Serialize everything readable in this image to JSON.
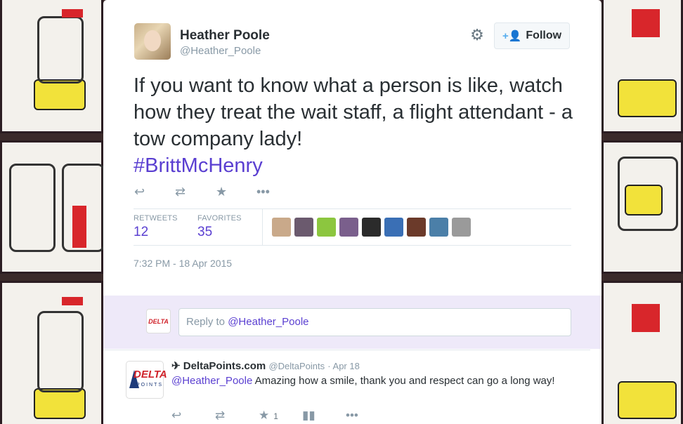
{
  "tweet": {
    "author_name": "Heather Poole",
    "author_handle": "@Heather_Poole",
    "follow_label": "Follow",
    "text": "If you want to know what a person is like, watch how they treat the wait staff, a flight attendant - a tow company lady!",
    "hashtag": "#BrittMcHenry",
    "retweets_label": "RETWEETS",
    "retweets_count": "12",
    "favorites_label": "FAVORITES",
    "favorites_count": "35",
    "timestamp": "7:32 PM - 18 Apr 2015",
    "favoriter_avatar_colors": [
      "#c9a98a",
      "#6b5a6e",
      "#8cc63f",
      "#7a5f8c",
      "#2b2b2b",
      "#3a6fb5",
      "#6b3a2a",
      "#4b7fa8",
      "#9a9a9a"
    ]
  },
  "reply_box": {
    "prefix": "Reply to ",
    "mention": "@Heather_Poole"
  },
  "reply_tweet": {
    "name": "✈ DeltaPoints.com",
    "handle": "@DeltaPoints",
    "date": "· Apr 18",
    "mention": "@Heather_Poole",
    "text": " Amazing how a smile, thank you and respect can go a long way!",
    "favorite_count": "1",
    "avatar_text_top": "DELTA",
    "avatar_text_bottom": "POINTS"
  },
  "icons": {
    "gear": "gear-icon",
    "reply": "reply-icon",
    "retweet": "retweet-icon",
    "favorite": "star-icon",
    "more": "more-icon",
    "follow": "add-user-icon"
  }
}
